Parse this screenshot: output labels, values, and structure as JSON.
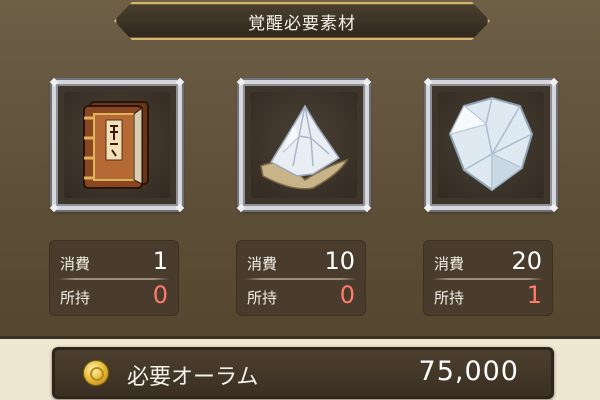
{
  "title": "覚醒必要素材",
  "materials": [
    {
      "name": "book-icon",
      "consume_label": "消費",
      "consume": "1",
      "owned_label": "所持",
      "owned": "0"
    },
    {
      "name": "crystal-shard-icon",
      "consume_label": "消費",
      "consume": "10",
      "owned_label": "所持",
      "owned": "0"
    },
    {
      "name": "crystal-icon",
      "consume_label": "消費",
      "consume": "20",
      "owned_label": "所持",
      "owned": "1"
    }
  ],
  "aurum": {
    "label": "必要オーラム",
    "value": "75,000",
    "icon": "aurum-coin-icon"
  },
  "colors": {
    "panel": "#5e5039",
    "owned_value": "#ff7b6b",
    "title_border": "#d6b66f"
  }
}
